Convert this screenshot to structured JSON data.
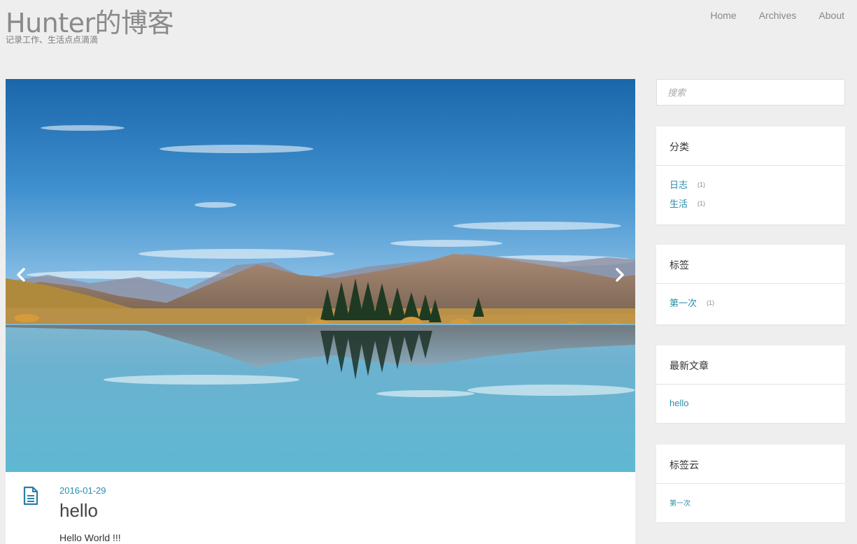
{
  "header": {
    "title": "Hunter的博客",
    "subtitle": "记录工作、生活点点滴滴",
    "nav": [
      "Home",
      "Archives",
      "About"
    ]
  },
  "banner": {
    "prev_icon": "chevron-left-icon",
    "next_icon": "chevron-right-icon"
  },
  "post": {
    "date": "2016-01-29",
    "title": "hello",
    "excerpt": "Hello World !!!",
    "icon": "document-icon"
  },
  "search": {
    "placeholder": "搜索"
  },
  "widgets": {
    "categories": {
      "title": "分类",
      "items": [
        {
          "label": "日志",
          "count": "(1)"
        },
        {
          "label": "生活",
          "count": "(1)"
        }
      ]
    },
    "tags": {
      "title": "标签",
      "items": [
        {
          "label": "第一次",
          "count": "(1)"
        }
      ]
    },
    "recent": {
      "title": "最新文章",
      "items": [
        {
          "label": "hello"
        }
      ]
    },
    "tagcloud": {
      "title": "标签云",
      "items": [
        {
          "label": "第一次"
        }
      ]
    }
  },
  "colors": {
    "background": "#eeeeee",
    "link": "#2a8dac",
    "title_gray": "#8a8a8a"
  }
}
